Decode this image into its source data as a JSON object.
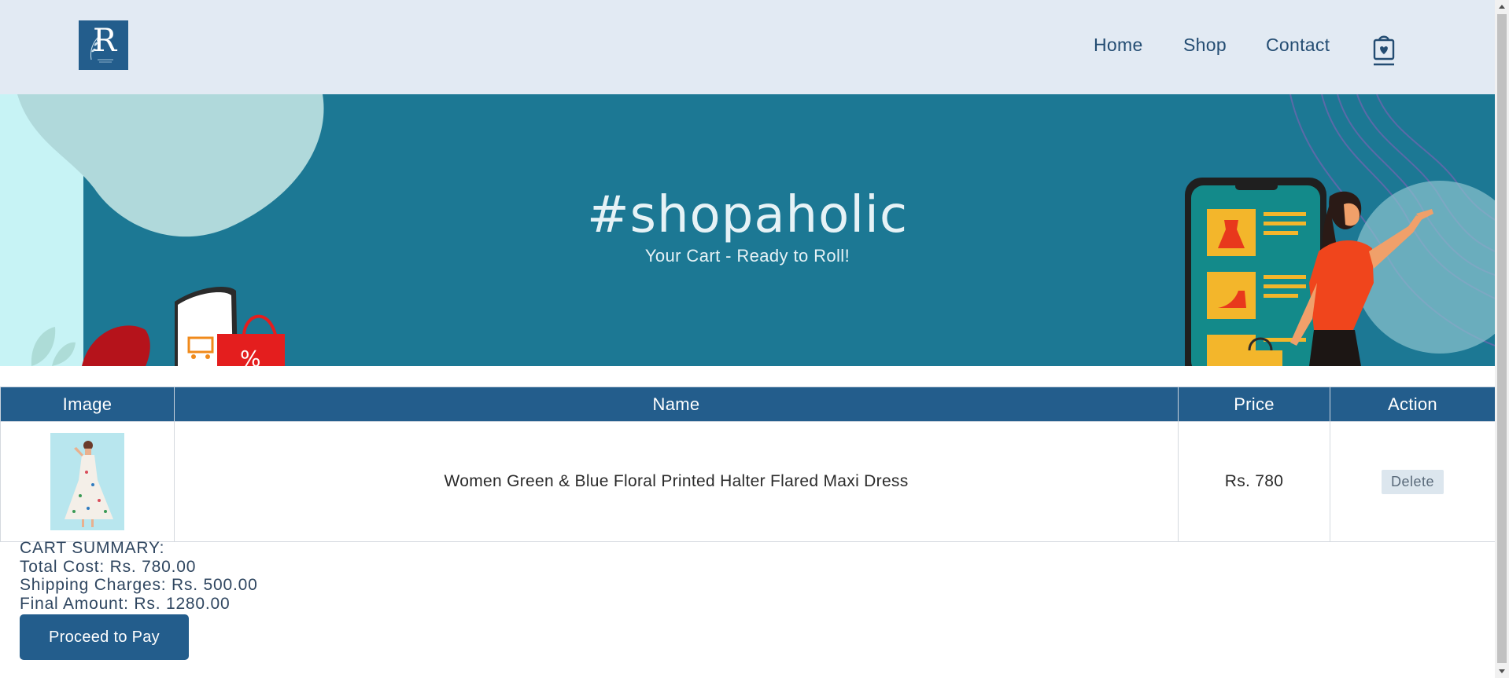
{
  "brand": {
    "logo_letter": "R",
    "colors": {
      "primary": "#235d8c",
      "header_bg": "#e2eaf3",
      "hero_bg": "#1c7894"
    }
  },
  "nav": {
    "items": [
      {
        "label": "Home"
      },
      {
        "label": "Shop"
      },
      {
        "label": "Contact"
      }
    ],
    "cart_icon": "shopping-bag-icon"
  },
  "hero": {
    "title": "#shopaholic",
    "subtitle": "Your Cart - Ready to Roll!"
  },
  "cart_table": {
    "headers": [
      "Image",
      "Name",
      "Price",
      "Action"
    ],
    "rows": [
      {
        "name": "Women Green & Blue Floral Printed Halter Flared Maxi Dress",
        "price": "Rs. 780",
        "action": "Delete"
      }
    ]
  },
  "summary": {
    "heading": "CART SUMMARY:",
    "total_cost": "Total Cost: Rs. 780.00",
    "shipping": "Shipping Charges: Rs. 500.00",
    "final_amount": "Final Amount: Rs. 1280.00",
    "pay_label": "Proceed to Pay"
  }
}
